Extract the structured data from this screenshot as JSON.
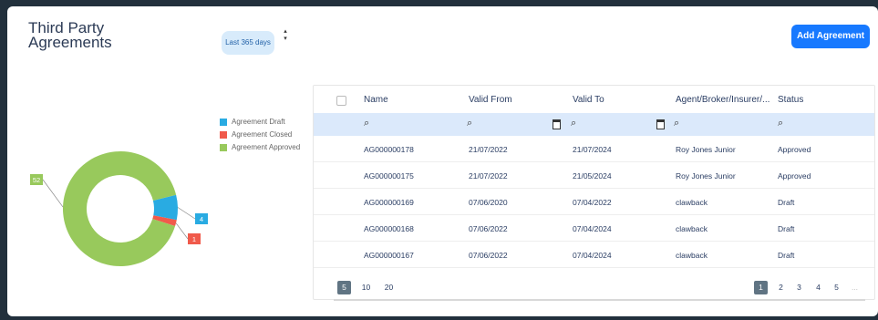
{
  "title": "Third Party Agreements",
  "range_label": "Last 365 days",
  "add_button": "Add Agreement",
  "chart_data": {
    "type": "pie",
    "categories": [
      "Agreement Draft",
      "Agreement Closed",
      "Agreement Approved"
    ],
    "values": [
      4,
      1,
      52
    ],
    "colors": [
      "#29abe2",
      "#f05a4b",
      "#98c95c"
    ],
    "data_labels": [
      "4",
      "1",
      "52"
    ],
    "legend": "right"
  },
  "legend": [
    {
      "label": "Agreement Draft",
      "color": "#29abe2"
    },
    {
      "label": "Agreement Closed",
      "color": "#f05a4b"
    },
    {
      "label": "Agreement Approved",
      "color": "#98c95c"
    }
  ],
  "table": {
    "columns": [
      "Name",
      "Valid From",
      "Valid To",
      "Agent/Broker/Insurer/...",
      "Status"
    ],
    "rows": [
      [
        "AG000000178",
        "21/07/2022",
        "21/07/2024",
        "Roy Jones Junior",
        "Approved"
      ],
      [
        "AG000000175",
        "21/07/2022",
        "21/05/2024",
        "Roy Jones Junior",
        "Approved"
      ],
      [
        "AG000000169",
        "07/06/2020",
        "07/04/2022",
        "clawback",
        "Draft"
      ],
      [
        "AG000000168",
        "07/06/2022",
        "07/04/2024",
        "clawback",
        "Draft"
      ],
      [
        "AG000000167",
        "07/06/2022",
        "07/04/2024",
        "clawback",
        "Draft"
      ]
    ]
  },
  "pager": {
    "page_sizes": [
      "5",
      "10",
      "20"
    ],
    "pages": [
      "1",
      "2",
      "3",
      "4",
      "5"
    ],
    "ellipsis": "..."
  }
}
